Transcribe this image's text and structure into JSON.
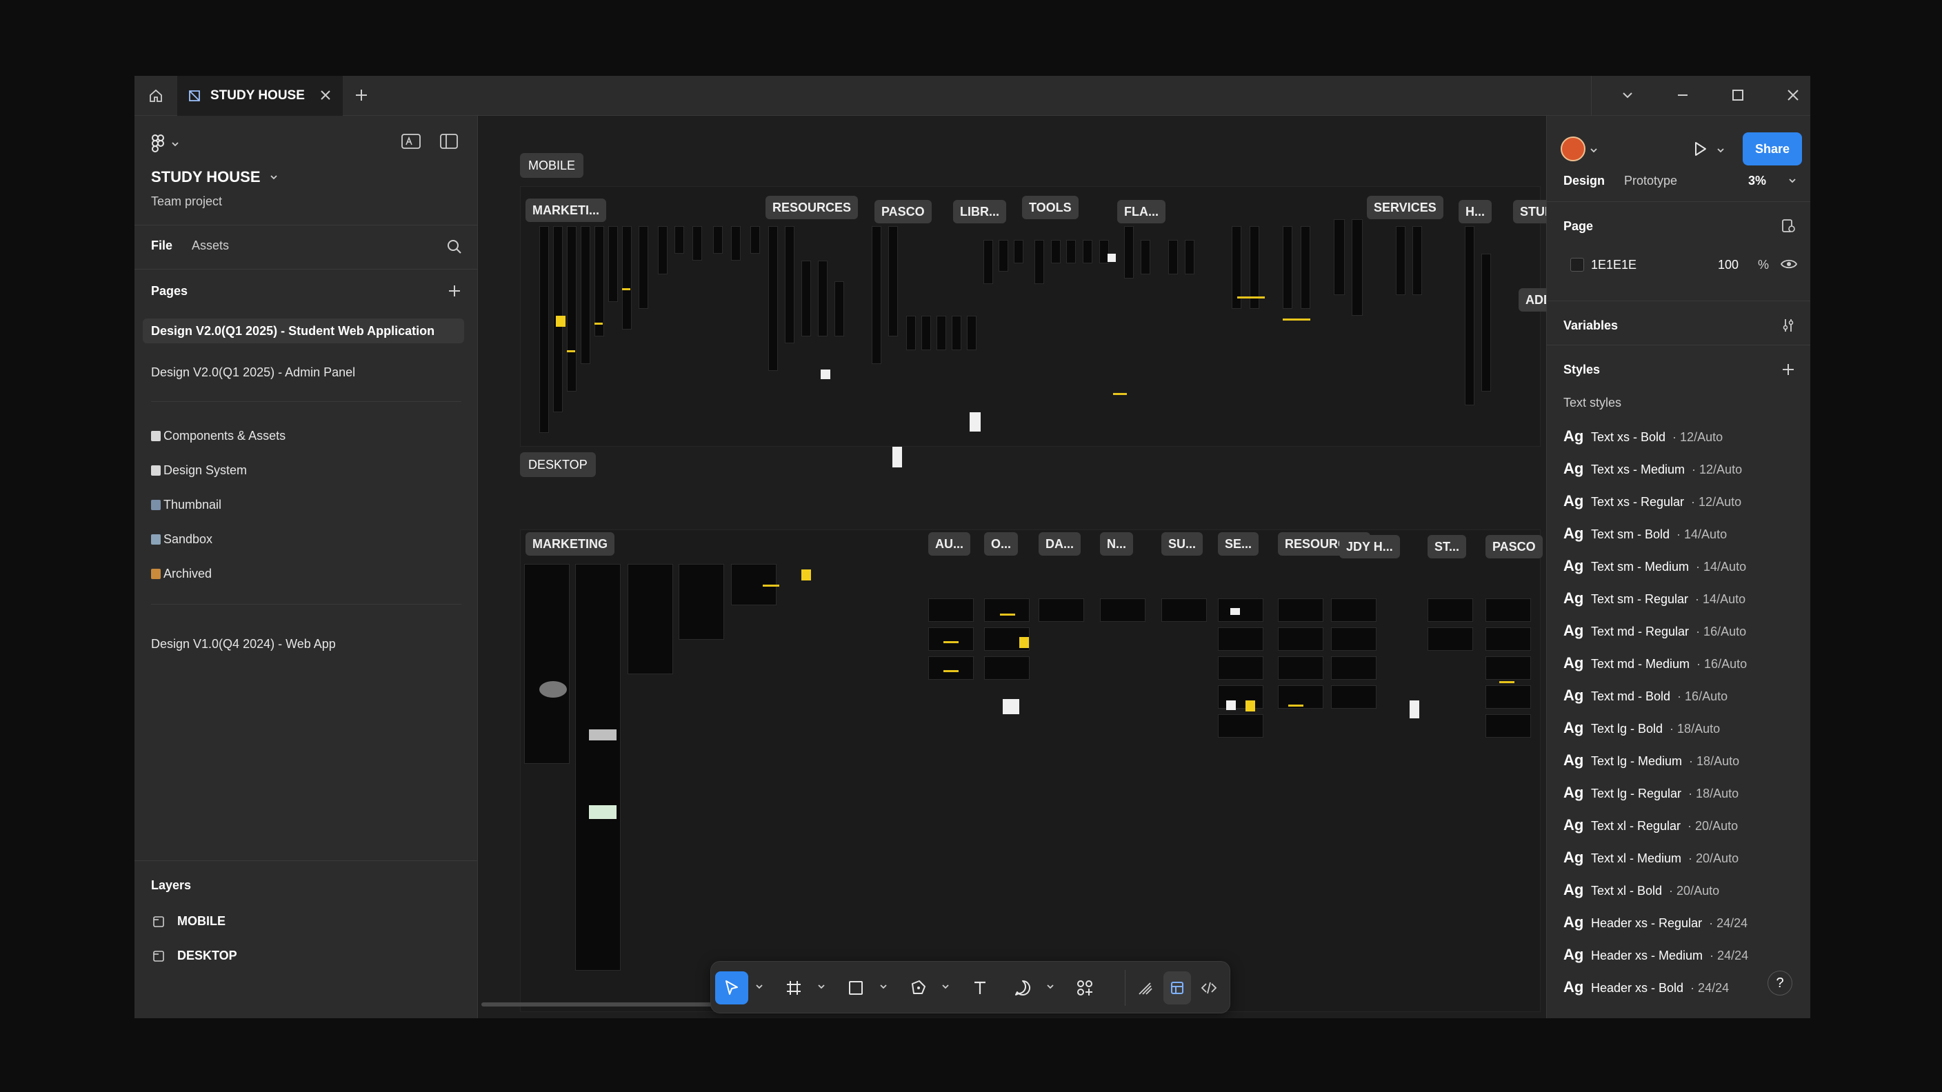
{
  "titlebar": {
    "tab_title": "STUDY HOUSE"
  },
  "left_panel": {
    "project_title": "STUDY HOUSE",
    "project_subtitle": "Team project",
    "tabs": {
      "file": "File",
      "assets": "Assets"
    },
    "pages_title": "Pages",
    "pages": [
      "Design V2.0(Q1 2025) - Student Web Application",
      "Design V2.0(Q1 2025) - Admin Panel",
      "Components & Assets",
      "Design System",
      "Thumbnail",
      "Sandbox",
      "Archived",
      "Design V1.0(Q4 2024) - Web App"
    ],
    "layers_title": "Layers",
    "layers": [
      "MOBILE",
      "DESKTOP"
    ]
  },
  "canvas": {
    "sections": {
      "mobile": "MOBILE",
      "desktop": "DESKTOP"
    },
    "mobile_frames": [
      "MARKETI...",
      "RESOURCES",
      "PASCO",
      "LIBR...",
      "TOOLS",
      "FLA...",
      "SERVICES",
      "H...",
      "STUDE...",
      "ADD N..."
    ],
    "desktop_frames": [
      "MARKETING",
      "AU...",
      "O...",
      "DA...",
      "N...",
      "SU...",
      "SE...",
      "RESOURCES",
      "JDY H...",
      "ST...",
      "PASCO"
    ]
  },
  "toolbar": {
    "tools": [
      "move-tool",
      "frame-tool",
      "rectangle-tool",
      "pen-tool",
      "text-tool",
      "comment-tool",
      "actions-tool",
      "draw-mode",
      "design-mode",
      "dev-mode"
    ]
  },
  "right_panel": {
    "share": "Share",
    "tabs": {
      "design": "Design",
      "prototype": "Prototype"
    },
    "zoom": "3%",
    "page_title": "Page",
    "page_color": "1E1E1E",
    "page_opacity": "100",
    "percent": "%",
    "variables_title": "Variables",
    "styles_title": "Styles",
    "text_styles_title": "Text styles",
    "ag": "Ag",
    "text_styles": [
      {
        "name": "Text xs - Bold",
        "meta": "· 12/Auto"
      },
      {
        "name": "Text xs - Medium",
        "meta": "· 12/Auto"
      },
      {
        "name": "Text xs - Regular",
        "meta": "· 12/Auto"
      },
      {
        "name": "Text sm - Bold",
        "meta": "· 14/Auto"
      },
      {
        "name": "Text sm - Medium",
        "meta": "· 14/Auto"
      },
      {
        "name": "Text sm - Regular",
        "meta": "· 14/Auto"
      },
      {
        "name": "Text md - Regular",
        "meta": "· 16/Auto"
      },
      {
        "name": "Text md - Medium",
        "meta": "· 16/Auto"
      },
      {
        "name": "Text md - Bold",
        "meta": "· 16/Auto"
      },
      {
        "name": "Text lg - Bold",
        "meta": "· 18/Auto"
      },
      {
        "name": "Text lg - Medium",
        "meta": "· 18/Auto"
      },
      {
        "name": "Text lg - Regular",
        "meta": "· 18/Auto"
      },
      {
        "name": "Text xl - Regular",
        "meta": "· 20/Auto"
      },
      {
        "name": "Text xl - Medium",
        "meta": "· 20/Auto"
      },
      {
        "name": "Text xl - Bold",
        "meta": "· 20/Auto"
      },
      {
        "name": "Header xs - Regular",
        "meta": "· 24/24"
      },
      {
        "name": "Header xs - Medium",
        "meta": "· 24/24"
      },
      {
        "name": "Header xs - Bold",
        "meta": "· 24/24"
      }
    ],
    "help": "?"
  },
  "colors": {
    "accent": "#2f86f0",
    "canvas_bg": "#1e1e1e",
    "panel_bg": "#2c2c2c",
    "highlight_yellow": "#f2cf1d"
  }
}
